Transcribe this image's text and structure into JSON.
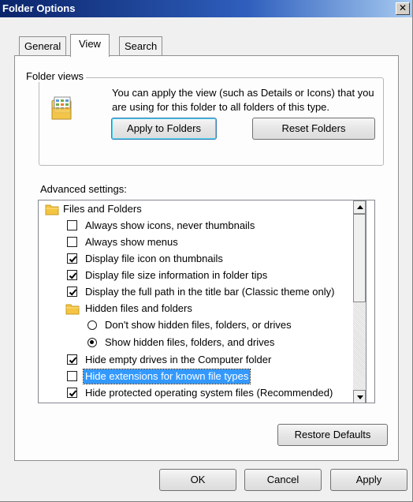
{
  "window": {
    "title": "Folder Options",
    "close_glyph": "✕"
  },
  "tabs": [
    {
      "label": "General",
      "active": false
    },
    {
      "label": "View",
      "active": true
    },
    {
      "label": "Search",
      "active": false
    }
  ],
  "folder_views": {
    "group_label": "Folder views",
    "description": "You can apply the view (such as Details or Icons) that you are using for this folder to all folders of this type.",
    "icon": "folder-view-icon",
    "apply_button": "Apply to Folders",
    "reset_button": "Reset Folders"
  },
  "advanced": {
    "label": "Advanced settings:",
    "items": [
      {
        "type": "folder",
        "label": "Files and Folders"
      },
      {
        "type": "checkbox",
        "label": "Always show icons, never thumbnails",
        "checked": false
      },
      {
        "type": "checkbox",
        "label": "Always show menus",
        "checked": false
      },
      {
        "type": "checkbox",
        "label": "Display file icon on thumbnails",
        "checked": true
      },
      {
        "type": "checkbox",
        "label": "Display file size information in folder tips",
        "checked": true
      },
      {
        "type": "checkbox",
        "label": "Display the full path in the title bar (Classic theme only)",
        "checked": true
      },
      {
        "type": "folder",
        "label": "Hidden files and folders"
      },
      {
        "type": "radio",
        "label": "Don't show hidden files, folders, or drives",
        "checked": false
      },
      {
        "type": "radio",
        "label": "Show hidden files, folders, and drives",
        "checked": true
      },
      {
        "type": "checkbox",
        "label": "Hide empty drives in the Computer folder",
        "checked": true
      },
      {
        "type": "checkbox",
        "label": "Hide extensions for known file types",
        "checked": false,
        "selected": true
      },
      {
        "type": "checkbox",
        "label": "Hide protected operating system files (Recommended)",
        "checked": true
      }
    ],
    "restore_button": "Restore Defaults"
  },
  "footer": {
    "ok": "OK",
    "cancel": "Cancel",
    "apply": "Apply"
  },
  "colors": {
    "selection": "#3399ff",
    "title_bar": "#0a246a",
    "folder": "#f4c542"
  }
}
